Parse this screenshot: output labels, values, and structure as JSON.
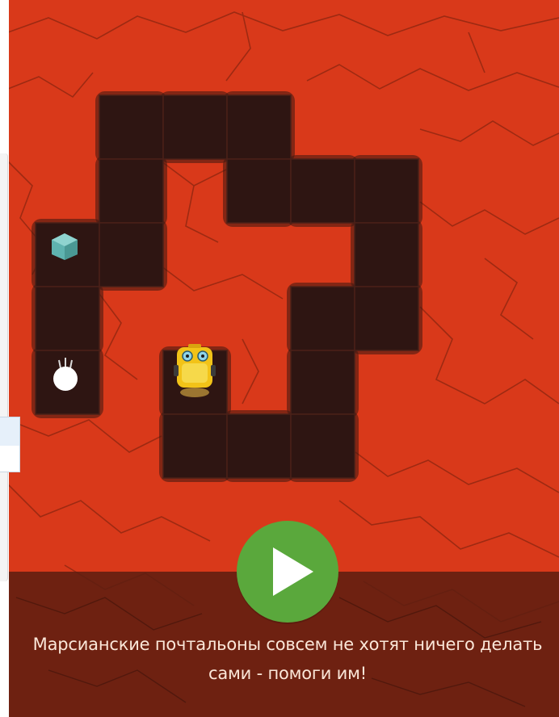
{
  "game": {
    "colors": {
      "mars_ground": "#d9391a",
      "crack_lines": "#8a2510",
      "path_tile": "#2e1512",
      "path_grid_line": "#4a2018",
      "bottom_band": "#5c1d10",
      "play_button": "#5aa83c",
      "caption_text": "#fbe7d9"
    },
    "sprites": {
      "robot": "yellow-robot-postman",
      "package": "teal-package-box",
      "goal": "white-ball"
    },
    "play_button": {
      "icon": "play-icon"
    },
    "caption": {
      "line1": "Марсианские почтальоны совсем не хотят ничего делать",
      "line2": "сами - помоги им!"
    }
  }
}
